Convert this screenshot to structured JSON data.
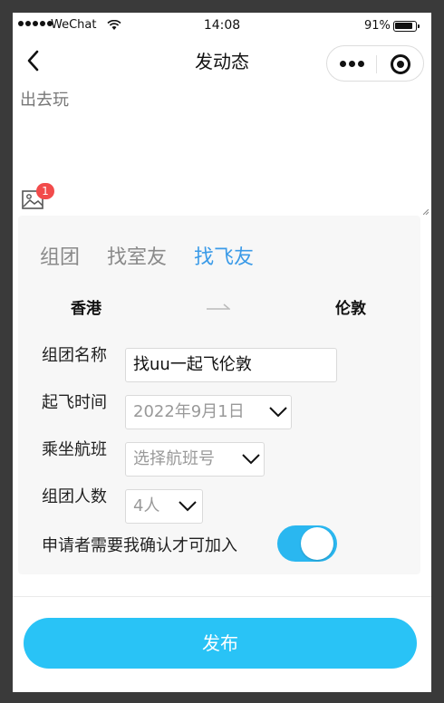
{
  "status_bar": {
    "carrier": "WeChat",
    "time": "14:08",
    "battery_percent": "91%",
    "battery_level": 0.91
  },
  "nav": {
    "title": "发动态",
    "back_icon": "chevron-left-icon",
    "more_icon": "more-dots-icon",
    "close_icon": "target-close-icon"
  },
  "post": {
    "text": "出去玩",
    "image_count": "1"
  },
  "tabs": [
    {
      "label": "组团",
      "active": false
    },
    {
      "label": "找室友",
      "active": false
    },
    {
      "label": "找飞友",
      "active": true
    }
  ],
  "route": {
    "from": "香港",
    "to": "伦敦"
  },
  "form": {
    "group_name_label": "组团名称",
    "group_name_value": "找uu一起飞伦敦",
    "departure_label": "起飞时间",
    "departure_value": "2022年9月1日",
    "flight_label": "乘坐航班",
    "flight_placeholder": "选择航班号",
    "size_label": "组团人数",
    "size_value": "4人",
    "approval_label": "申请者需要我确认才可加入",
    "approval_enabled": true
  },
  "publish_label": "发布",
  "colors": {
    "accent": "#3b9be8",
    "toggle": "#2ab7f0",
    "publish": "#29c3f6",
    "badge": "#f24b4b"
  }
}
